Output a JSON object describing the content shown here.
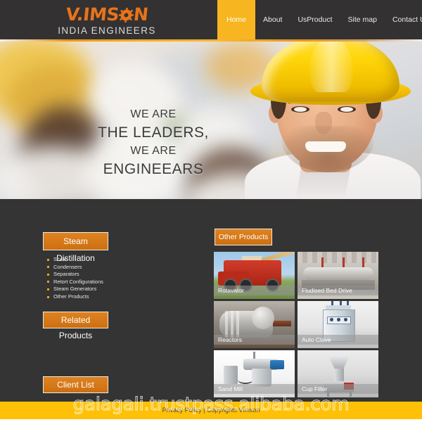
{
  "header": {
    "logo": {
      "brand_part1": "V.IMS",
      "brand_gear": "gear-icon",
      "brand_part2": "N",
      "tagline": "INDIA ENGINEERS",
      "brand_color": "#E8731A"
    },
    "nav": [
      {
        "label": "Home",
        "active": true
      },
      {
        "label": "About",
        "active": false
      },
      {
        "label": "UsProduct",
        "active": false
      },
      {
        "label": "Site map",
        "active": false
      },
      {
        "label": "Contact Us",
        "active": false
      }
    ],
    "active_color": "#F7B520",
    "background": "#333132"
  },
  "hero": {
    "line1": "WE ARE",
    "line2": "THE LEADERS,",
    "line3": "WE ARE",
    "line4": "ENGINEEARS",
    "image_alt": "engineer-with-yellow-hard-hat"
  },
  "sidebar": {
    "steam_button": "Steam Distillation",
    "items": [
      {
        "label": "Scale"
      },
      {
        "label": "Condensers"
      },
      {
        "label": "Separators"
      },
      {
        "label": "Retort Configurations"
      },
      {
        "label": "Steam Generators"
      },
      {
        "label": "Other Products"
      }
    ],
    "related_button": "Related Products",
    "client_button": "Client List",
    "button_color": "#D4761A"
  },
  "products": {
    "heading": "Other Products",
    "tiles": [
      {
        "label": "Rotavator"
      },
      {
        "label": "Fludised Bed Drive"
      },
      {
        "label": "Reactors"
      },
      {
        "label": "Auto Clave"
      },
      {
        "label": "Sand Mill"
      },
      {
        "label": "Cup Filler"
      }
    ]
  },
  "footer": {
    "text": "Privacy Policy | Copyrights Vimson",
    "background": "#FFC107"
  },
  "watermark": {
    "text": "galagali.trustpass.alibaba.com"
  }
}
